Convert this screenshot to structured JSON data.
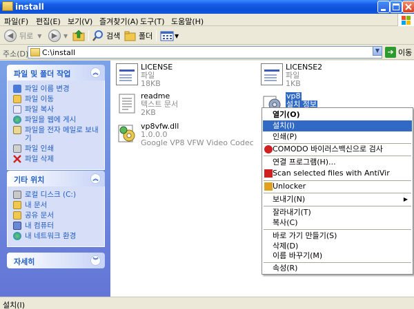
{
  "window": {
    "title": "install"
  },
  "menu": [
    "파일(F)",
    "편집(E)",
    "보기(V)",
    "즐겨찾기(A)",
    "도구(T)",
    "도움말(H)"
  ],
  "toolbar": {
    "back_label": "뒤로",
    "search_label": "검색",
    "folders_label": "폴더"
  },
  "address": {
    "label": "주소(D)",
    "value": "C:\\install",
    "go_label": "이동"
  },
  "tasks_panel": {
    "title": "파일 및 폴더 작업",
    "items": [
      "파일 이름 변경",
      "파일 이동",
      "파일 복사",
      "파일을 웹에 게시",
      "파일을 전자 메일로 보내기",
      "파일 인쇄",
      "파일 삭제"
    ]
  },
  "places_panel": {
    "title": "기타 위치",
    "items": [
      "로컬 디스크 (C:)",
      "내 문서",
      "공유 문서",
      "내 컴퓨터",
      "내 네트워크 환경"
    ]
  },
  "details_panel": {
    "title": "자세히"
  },
  "files": [
    {
      "name": "LICENSE",
      "type": "파일",
      "size": "18KB"
    },
    {
      "name": "LICENSE2",
      "type": "파일",
      "size": "1KB"
    },
    {
      "name": "readme",
      "type": "텍스트 문서",
      "size": "2KB"
    },
    {
      "name": "vp8",
      "type": "설치 정보"
    },
    {
      "name": "vp8vfw.dll",
      "version": "1.0.0.0",
      "description": "Google VP8 VFW Video Codec"
    }
  ],
  "context_menu": {
    "open": "열기(O)",
    "install": "설치(I)",
    "print": "인쇄(P)",
    "comodo_scan": "COMODO 바이러스백신으로 검사",
    "open_with": "연결 프로그램(H)...",
    "antivir_scan": "Scan selected files with AntiVir",
    "unlocker": "Unlocker",
    "send_to": "보내기(N)",
    "cut": "잘라내기(T)",
    "copy": "복사(C)",
    "create_shortcut": "바로 가기 만들기(S)",
    "delete": "삭제(D)",
    "rename": "이름 바꾸기(M)",
    "properties": "속성(R)"
  },
  "status": {
    "text": "설치(I)"
  }
}
